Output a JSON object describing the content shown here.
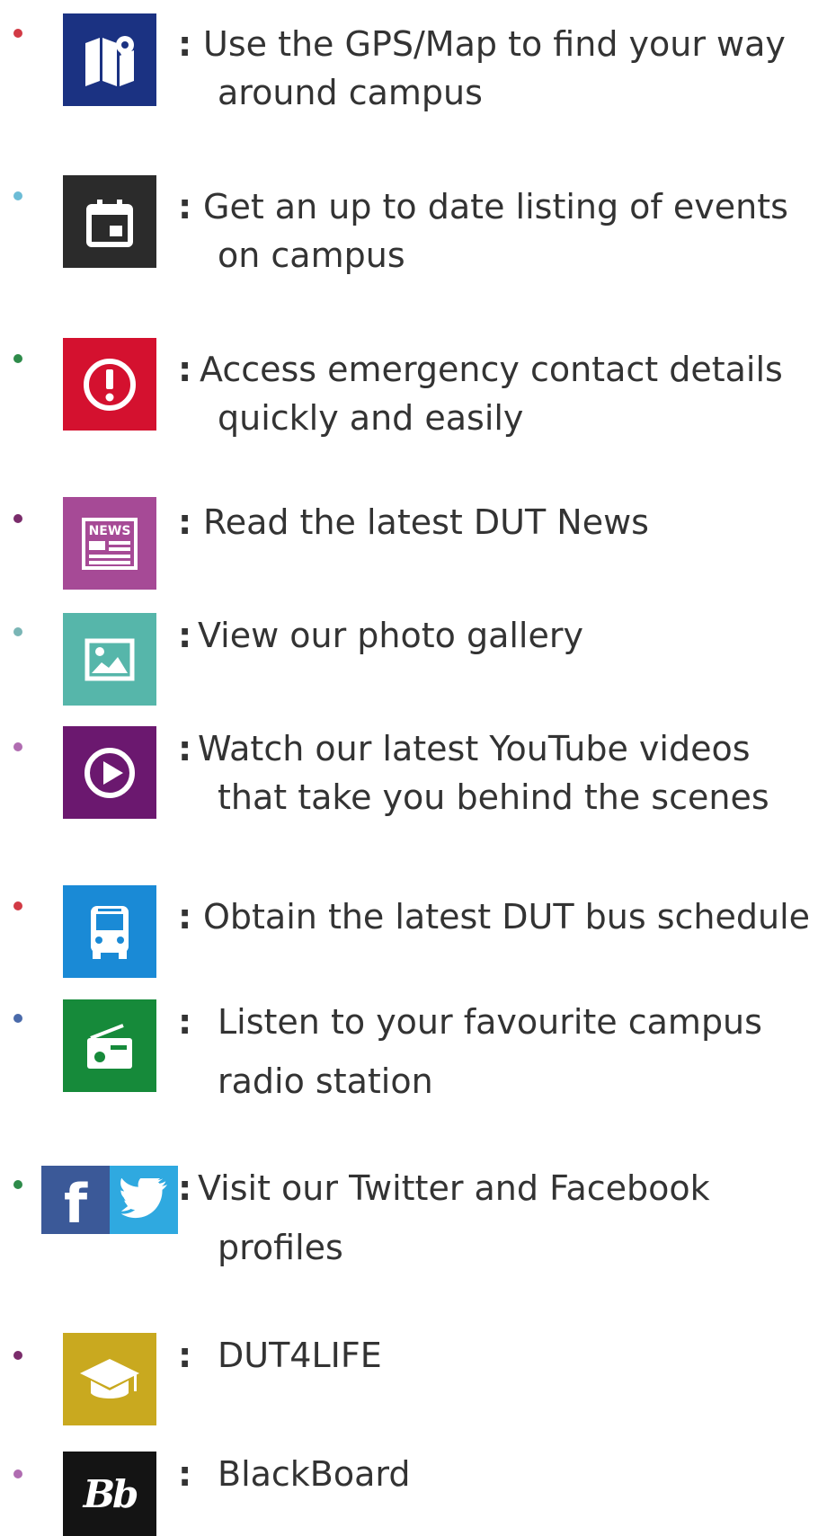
{
  "items": [
    {
      "line1": "Use the GPS/Map to find your way",
      "line2": "around campus",
      "icon": "map-pin-icon",
      "icon_color": "#1b3282",
      "bullet_color": "#d23a45"
    },
    {
      "line1": "Get an up to date listing of events",
      "line2": "on campus",
      "icon": "calendar-icon",
      "icon_color": "#2b2b2b",
      "bullet_color": "#6cbcd6"
    },
    {
      "line1": "Access emergency contact details",
      "line2": "quickly and easily",
      "icon": "alert-icon",
      "icon_color": "#d4112f",
      "bullet_color": "#2e8b4a"
    },
    {
      "line1": "Read the latest DUT News",
      "line2": "",
      "icon": "news-icon",
      "icon_color": "#a64a96",
      "icon_text": "NEWS",
      "bullet_color": "#7a2c6b"
    },
    {
      "line1": "View our photo gallery",
      "line2": "",
      "icon": "photo-icon",
      "icon_color": "#56b6aa",
      "bullet_color": "#7ab5b5"
    },
    {
      "line1": "Watch our latest YouTube videos",
      "line2": "that take you behind the scenes",
      "icon": "play-icon",
      "icon_color": "#6b186f",
      "bullet_color": "#b06cb1"
    },
    {
      "line1": "Obtain the latest DUT bus schedule",
      "line2": "",
      "icon": "bus-icon",
      "icon_color": "#1a8ad6",
      "bullet_color": "#d23a45"
    },
    {
      "line1": "Listen to your favourite campus",
      "line2": "radio station",
      "icon": "radio-icon",
      "icon_color": "#168a3a",
      "bullet_color": "#4a6aaa"
    },
    {
      "line1": "Visit our Twitter and Facebook",
      "line2": "profiles",
      "icon": "facebook-twitter-icon",
      "facebook_color": "#3b5998",
      "twitter_color": "#2fa9e0",
      "facebook_text": "f",
      "bullet_color": "#2e8b4a"
    },
    {
      "line1": "DUT4LIFE",
      "line2": "",
      "icon": "graduation-cap-icon",
      "icon_color": "#c9a91f",
      "bullet_color": "#7a2c6b"
    },
    {
      "line1": "BlackBoard",
      "line2": "",
      "icon": "blackboard-icon",
      "icon_color": "#141414",
      "icon_text": "Bb",
      "bullet_color": "#b06cb1"
    }
  ],
  "separator": ":"
}
